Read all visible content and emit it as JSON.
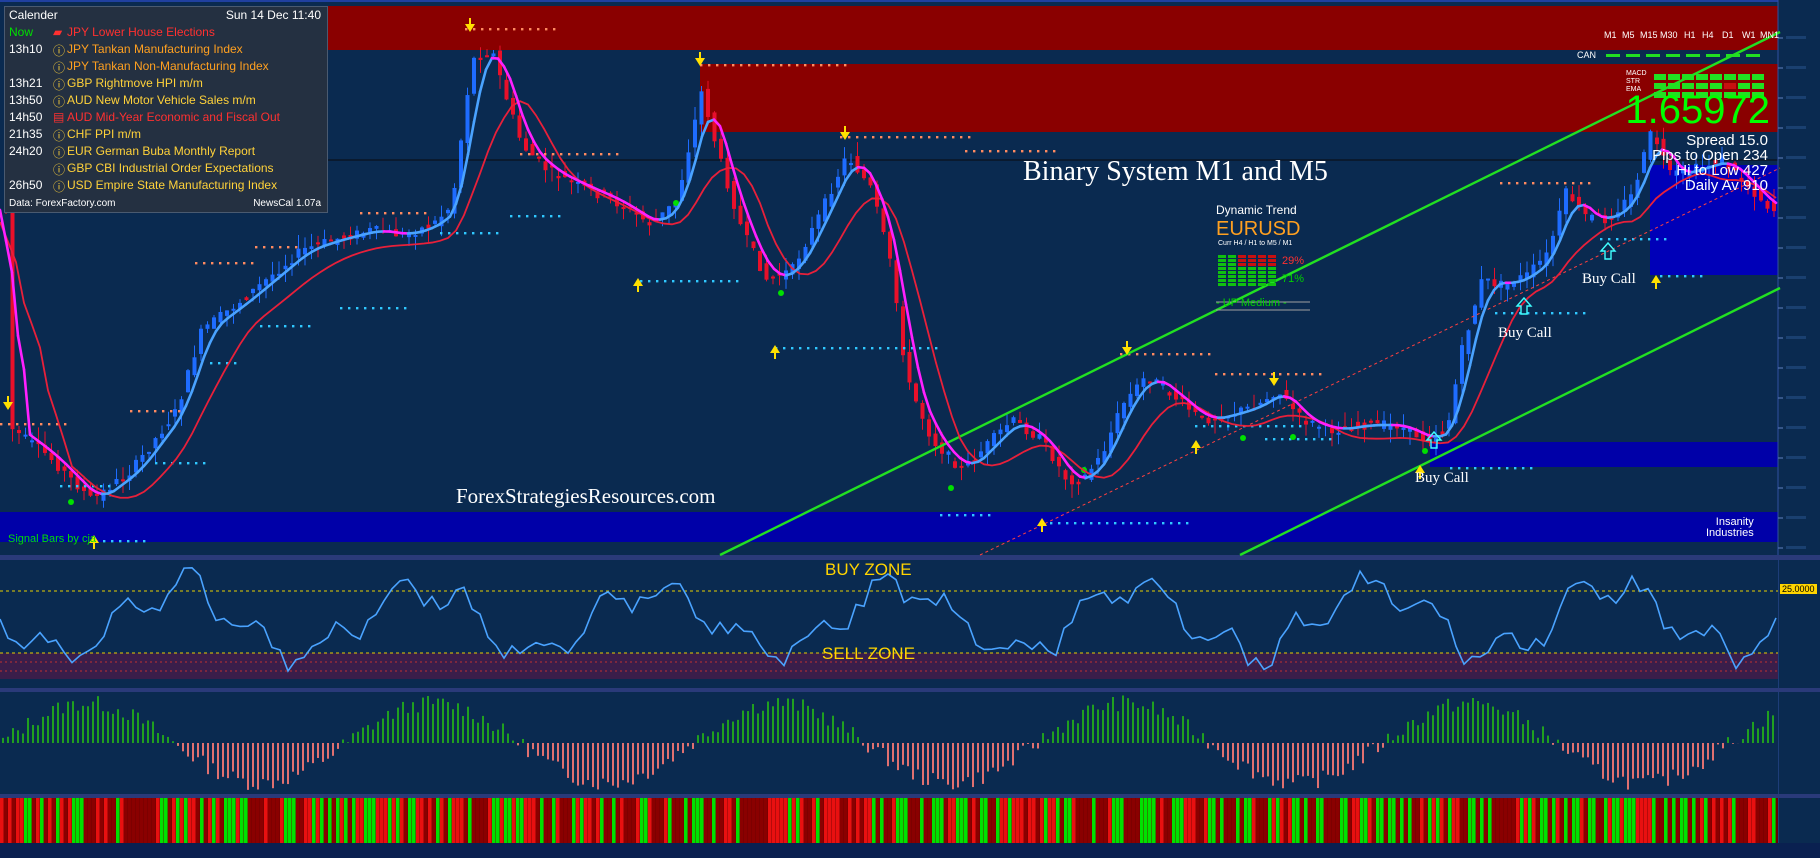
{
  "calendar": {
    "title": "Calender",
    "date": "Sun 14 Dec 11:40",
    "source": "Data: ForexFactory.com",
    "version": "NewsCal 1.07a",
    "events": [
      {
        "time": "Now",
        "icon": "truck-icon",
        "text": "JPY  Lower House Elections",
        "time_color": "#00e000",
        "color": "#ff3030"
      },
      {
        "time": "13h10",
        "icon": "info-icon",
        "text": "JPY  Tankan Manufacturing Index",
        "time_color": "#ffffff",
        "color": "#ffa020"
      },
      {
        "time": "",
        "icon": "info-icon",
        "text": "JPY  Tankan Non-Manufacturing Index",
        "time_color": "#ffffff",
        "color": "#ffa020"
      },
      {
        "time": "13h21",
        "icon": "info-icon",
        "text": "GBP Rightmove HPI m/m",
        "time_color": "#ffffff",
        "color": "#ffd23a"
      },
      {
        "time": "13h50",
        "icon": "info-icon",
        "text": "AUD New Motor Vehicle Sales m/m",
        "time_color": "#ffffff",
        "color": "#ffd23a"
      },
      {
        "time": "14h50",
        "icon": "document-icon",
        "text": "AUD Mid-Year Economic and Fiscal Out",
        "time_color": "#ffffff",
        "color": "#ff3030"
      },
      {
        "time": "21h35",
        "icon": "info-icon",
        "text": "CHF  PPI m/m",
        "time_color": "#ffffff",
        "color": "#ffd23a"
      },
      {
        "time": "24h20",
        "icon": "info-icon",
        "text": "EUR German Buba Monthly Report",
        "time_color": "#ffffff",
        "color": "#ffd23a"
      },
      {
        "time": "",
        "icon": "info-icon",
        "text": "GBP CBI Industrial Order Expectations",
        "time_color": "#ffffff",
        "color": "#ffd23a"
      },
      {
        "time": "26h50",
        "icon": "info-icon",
        "text": "USD Empire State Manufacturing Index",
        "time_color": "#ffffff",
        "color": "#ffd23a"
      }
    ]
  },
  "chart": {
    "title": "Binary System M1 and M5",
    "watermark": "ForexStrategiesResources.com",
    "signal_label": "Signal Bars by cja",
    "buy_call_labels": [
      "Buy Call",
      "Buy Call",
      "Buy Call"
    ],
    "brand": [
      "Insanity",
      "Industries"
    ]
  },
  "dynamic_trend": {
    "title": "Dynamic Trend",
    "symbol": "EURUSD",
    "timeframes": "Curr  H4 / H1  to  M5 / M1",
    "pct_down": "29%",
    "pct_up": "71%",
    "status": "- UP Medium -"
  },
  "signal_panel": {
    "timeframes": [
      "M1",
      "M5",
      "M15",
      "M30",
      "H1",
      "H4",
      "D1",
      "W1",
      "MN1"
    ],
    "can_label": "CAN",
    "indicator_labels": [
      "MACD",
      "STR",
      "EMA"
    ],
    "price": "1.65972",
    "spread": "Spread 15.0",
    "pips_to_open": "Pips to Open  234",
    "hi_to_low": "Hi to Low  427",
    "daily_avg": "Daily Av  910"
  },
  "oscillator": {
    "buy_zone": "BUY ZONE",
    "sell_zone": "SELL ZONE",
    "level_tag": "25.0000"
  },
  "colors": {
    "background": "#0a2a50",
    "bull": "#1e6cff",
    "bear": "#e8102a",
    "fast_ma": "#4aa3ff",
    "fast_ma_down": "#ff20ff",
    "slow_ma": "#e8203a",
    "channel": "#22e022",
    "supply_zone": "#8a0000",
    "demand_zone": "#0000a8"
  }
}
